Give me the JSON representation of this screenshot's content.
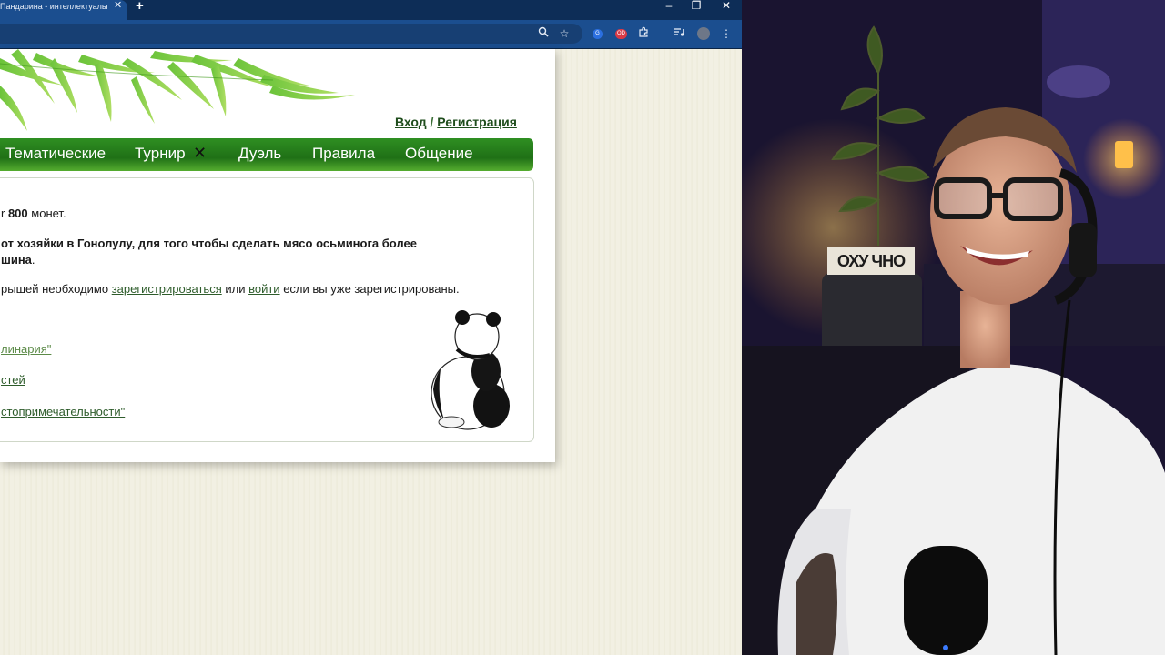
{
  "browser": {
    "tab_title": "Пандарина - интеллектуальн",
    "tab_close": "✕",
    "new_tab": "+",
    "window": {
      "minimize": "–",
      "restore": "❐",
      "close": "✕"
    },
    "toolbar_icons": [
      "zoom-icon",
      "star-icon",
      "extension-blue-icon",
      "extension-red-icon",
      "puzzle-icon",
      "media-icon",
      "profile-avatar",
      "menu-icon"
    ],
    "ext_blue_text": "G",
    "ext_red_text": "OD"
  },
  "site": {
    "login": "Вход",
    "separator": "/",
    "register": "Регистрация",
    "nav": [
      "Тематические",
      "Турнир",
      "Дуэль",
      "Правила",
      "Общение"
    ],
    "tournament_mark": "✕"
  },
  "content": {
    "coins_value": "800",
    "coins_word": "монет.",
    "question_line1": "от хозяйки в Гонолулу, для того чтобы сделать мясо осьминога более",
    "question_line2_bold": "шина",
    "question_line2_end": ".",
    "note_start": "рышей необходимо",
    "note_link1": "зарегистрироваться",
    "note_mid": "или",
    "note_link2": "войти",
    "note_end": "если вы уже зарегистрированы.",
    "topic1": "линария\"",
    "topic2": "стей",
    "topic3": "стопримечательности\""
  },
  "webcam": {
    "sign_text": "ОХУ ЧНО"
  }
}
